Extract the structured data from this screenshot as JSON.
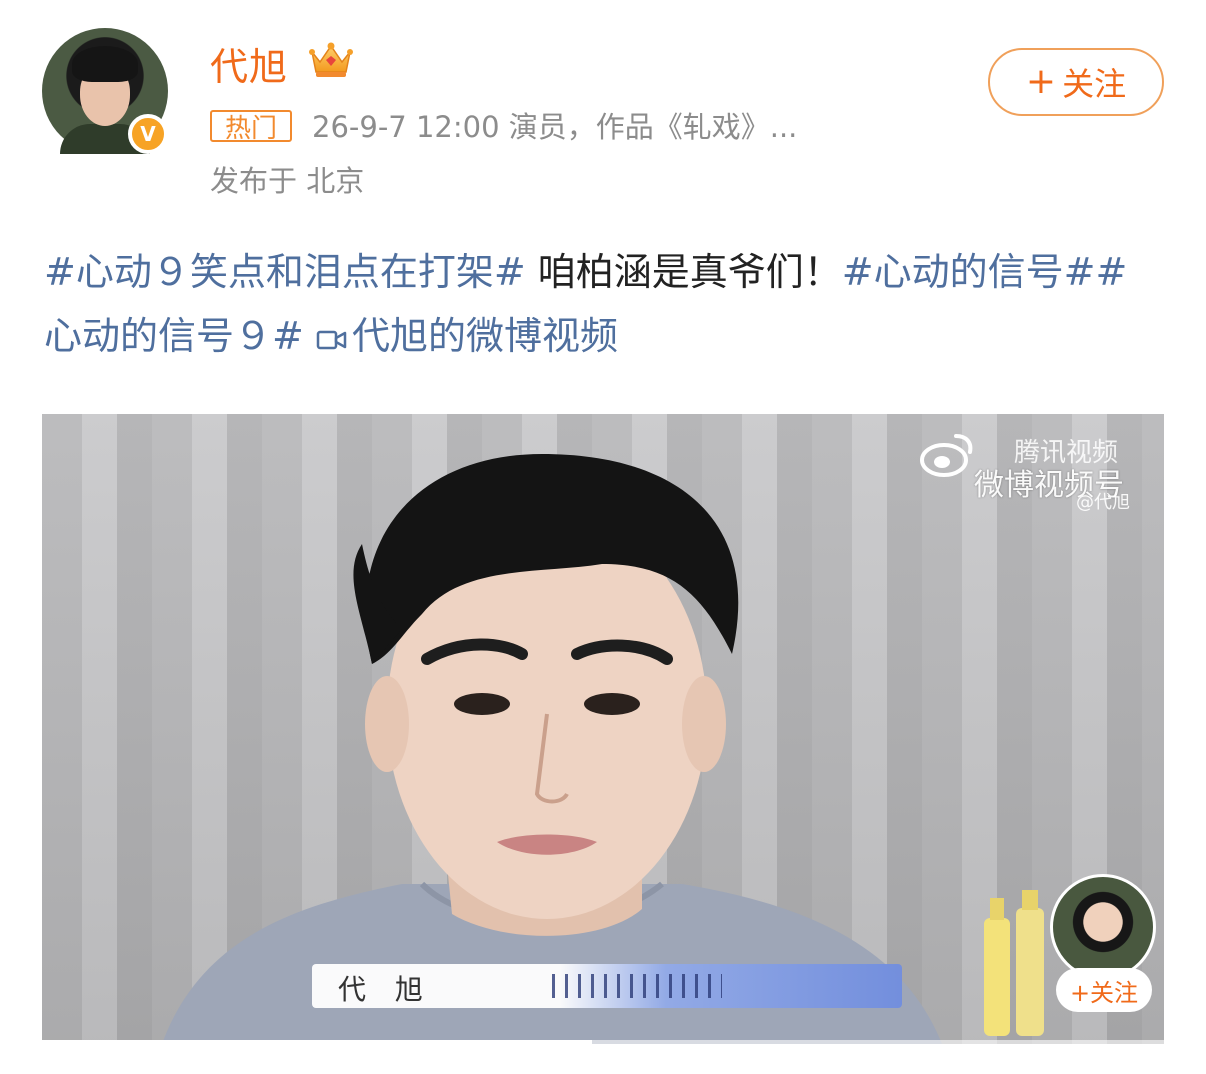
{
  "header": {
    "username": "代旭",
    "hot_tag": "热门",
    "meta": "26-9-7 12:00  演员，作品《轧戏》...",
    "location": "发布于 北京",
    "follow_label": "关注",
    "verified_badge": "V"
  },
  "post": {
    "tag1": "#心动９笑点和泪点在打架#",
    "text": " 咱柏涵是真爷们！",
    "tag2": "#心动的信号#",
    "tag3": "#心动的信号９#",
    "video_link": "代旭的微博视频"
  },
  "video": {
    "watermark_brand": "腾讯视频",
    "watermark_platform": "微博视频号",
    "watermark_handle": "@代旭",
    "name_caption": "代 旭",
    "pip_follow": "+关注",
    "progress": 0.49
  },
  "colors": {
    "accent": "#f06a1a",
    "link": "#4f6f9e"
  }
}
